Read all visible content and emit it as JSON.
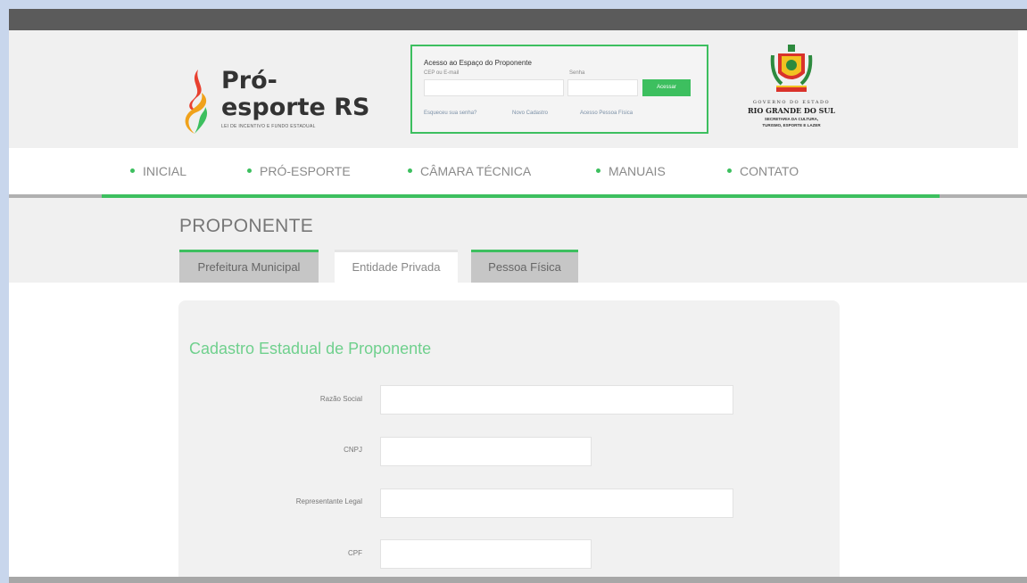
{
  "colors": {
    "accent": "#3dbf5f",
    "title_green": "#6fd08d",
    "topbar": "#5b5b5b"
  },
  "logo": {
    "brand_line1": "Pró-",
    "brand_line2": "esporte RS",
    "tagline": "LEI DE INCENTIVO E FUNDO ESTADUAL"
  },
  "login": {
    "title": "Acesso ao Espaço do Proponente",
    "user_label": "CEP ou E-mail",
    "pass_label": "Senha",
    "button": "Acessar",
    "links": [
      "Esqueceu sua senha?",
      "Novo Cadastro",
      "Acesso Pessoa Física"
    ]
  },
  "gov": {
    "line1": "GOVERNO DO ESTADO",
    "line2": "RIO GRANDE DO SUL",
    "line3": "SECRETARIA DA CULTURA,",
    "line4": "TURISMO, ESPORTE E LAZER"
  },
  "nav": {
    "items": [
      "INICIAL",
      "PRÓ-ESPORTE",
      "CÂMARA TÉCNICA",
      "MANUAIS",
      "CONTATO"
    ]
  },
  "page": {
    "title": "PROPONENTE"
  },
  "tabs": [
    {
      "label": "Prefeitura Municipal",
      "active": false
    },
    {
      "label": "Entidade Privada",
      "active": true
    },
    {
      "label": "Pessoa Física",
      "active": false
    }
  ],
  "form": {
    "title": "Cadastro Estadual de Proponente",
    "fields": [
      {
        "label": "Razão Social",
        "value": ""
      },
      {
        "label": "CNPJ",
        "value": ""
      },
      {
        "label": "Representante Legal",
        "value": ""
      },
      {
        "label": "CPF",
        "value": ""
      }
    ]
  }
}
